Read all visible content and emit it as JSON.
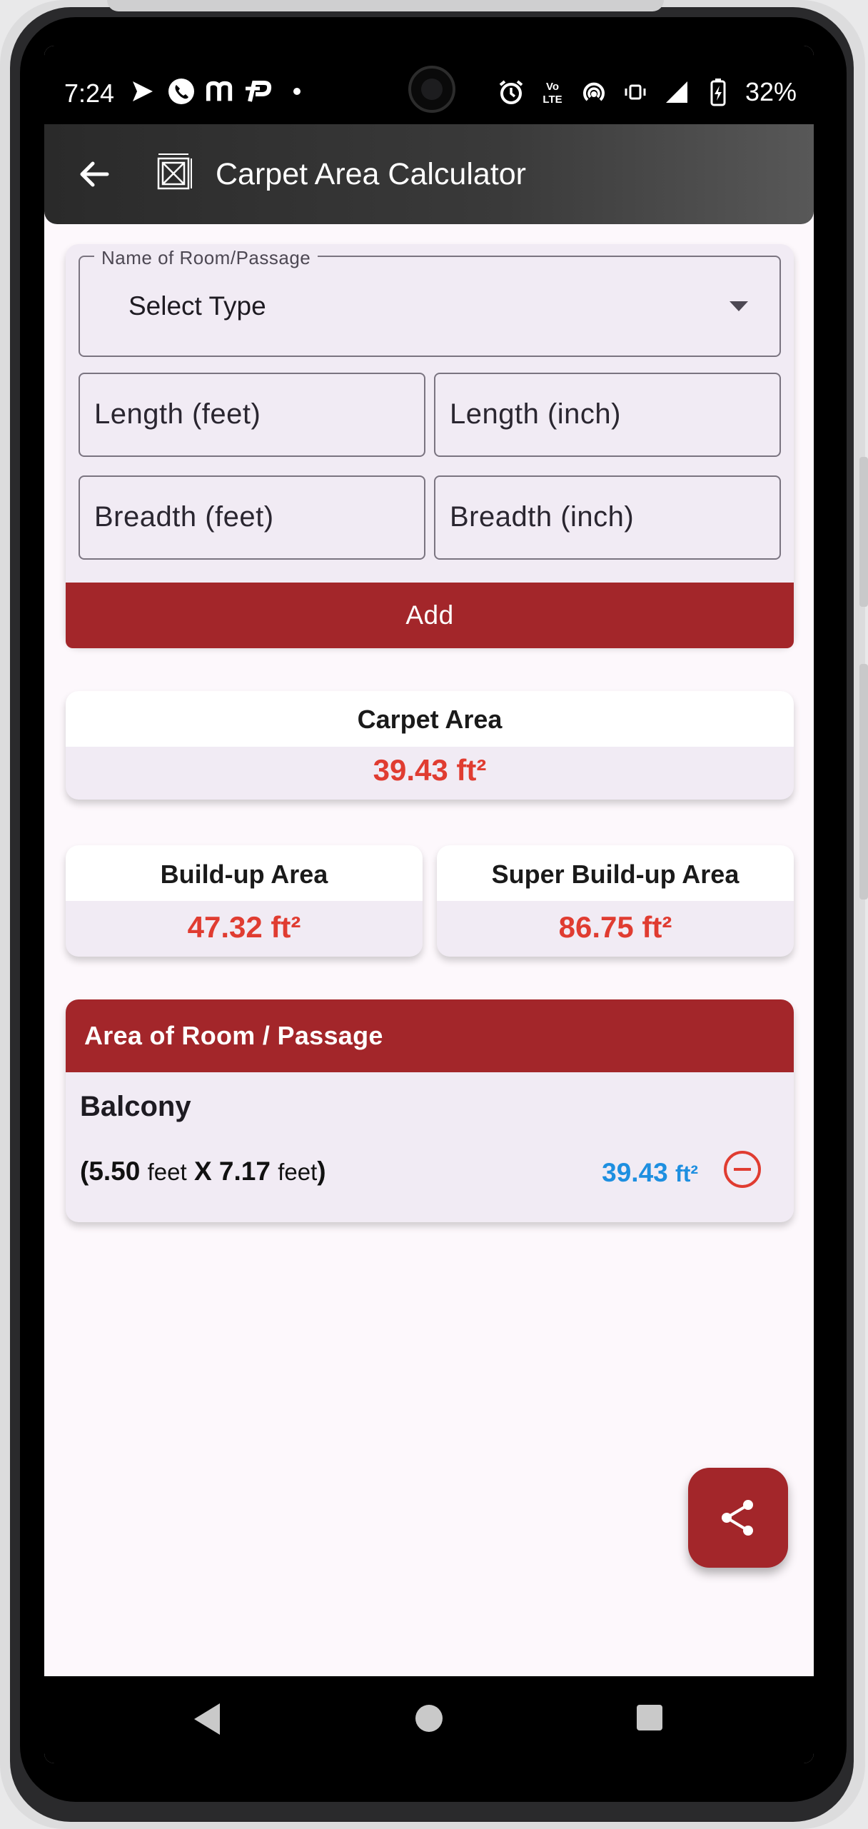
{
  "status_bar": {
    "time": "7:24",
    "battery": "32%",
    "left_icons": [
      "media-play-icon",
      "phone-icon",
      "m-app-icon",
      "payment-app-icon",
      "dot-icon"
    ],
    "right_icons": [
      "alarm-icon",
      "volte-icon",
      "hotspot-icon",
      "vibrate-icon",
      "signal-icon",
      "battery-charging-icon"
    ],
    "volte_label": "Vo\nLTE"
  },
  "app_bar": {
    "title": "Carpet Area Calculator",
    "back_icon": "arrow-left-icon",
    "logo_icon": "room-frame-icon"
  },
  "form": {
    "room_label": "Name of Room/Passage",
    "room_value": "Select Type",
    "length_feet_label": "Length (feet)",
    "length_inch_label": "Length (inch)",
    "breadth_feet_label": "Breadth (feet)",
    "breadth_inch_label": "Breadth (inch)",
    "add_label": "Add"
  },
  "results": {
    "carpet": {
      "label": "Carpet Area",
      "value": "39.43 ft²"
    },
    "buildup": {
      "label": "Build-up Area",
      "value": "47.32 ft²"
    },
    "super_buildup": {
      "label": "Super Build-up Area",
      "value": "86.75 ft²"
    }
  },
  "room_list": {
    "header": "Area of Room / Passage",
    "items": [
      {
        "name": "Balcony",
        "open_paren": "(",
        "length": "5.50",
        "length_unit": "feet",
        "x": "X",
        "breadth": "7.17",
        "breadth_unit": "feet",
        "close_paren": ")",
        "area": "39.43",
        "area_unit": "ft²"
      }
    ]
  },
  "colors": {
    "accent_red": "#a3262a",
    "value_red": "#e03c31",
    "value_blue": "#1e8fe0",
    "card_bg": "#f1ebf4"
  },
  "fab_icon": "share-icon"
}
